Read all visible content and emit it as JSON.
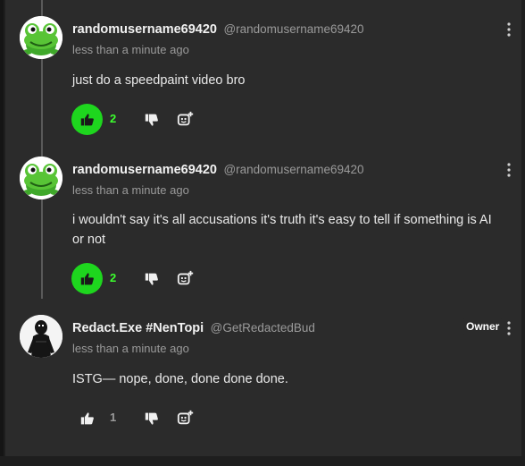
{
  "comments": [
    {
      "author": "randomusername69420",
      "handle": "@randomusername69420",
      "time": "less than a minute ago",
      "text": "just do a speedpaint video bro",
      "likes": "2",
      "liked": true,
      "avatar": "frog-avatar"
    },
    {
      "author": "randomusername69420",
      "handle": "@randomusername69420",
      "time": "less than a minute ago",
      "text": "i wouldn't say it's all accusations it's truth it's easy to tell if something is AI or not",
      "likes": "2",
      "liked": true,
      "avatar": "frog-avatar"
    },
    {
      "author": "Redact.Exe #NenTopi",
      "handle": "@GetRedactedBud",
      "time": "less than a minute ago",
      "text": "ISTG— nope, done, done done done.",
      "likes": "1",
      "liked": false,
      "badge": "Owner",
      "avatar": "dark-figure-avatar"
    }
  ],
  "colors": {
    "background": "#2b2b2b",
    "liked_green": "#1ed61e",
    "like_count_green": "#3cff2e",
    "thread_line": "#5a5a5a"
  },
  "icons": [
    "thumbs-up-icon",
    "thumbs-down-icon",
    "reply-icon",
    "more-vert-icon"
  ]
}
